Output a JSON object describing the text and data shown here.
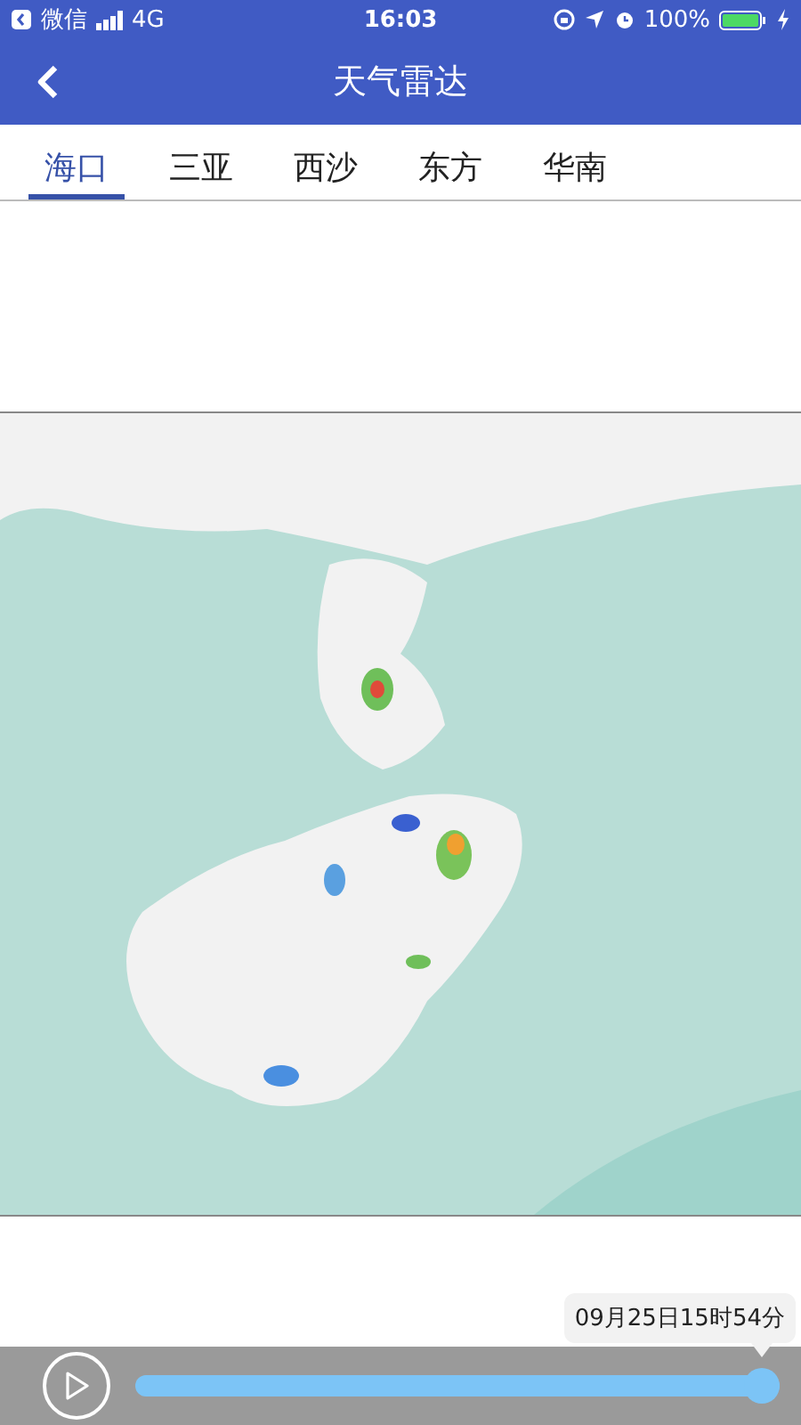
{
  "status_bar": {
    "back_app": "微信",
    "network": "4G",
    "time": "16:03",
    "battery": "100%"
  },
  "nav": {
    "title": "天气雷达"
  },
  "tabs": [
    {
      "label": "海口",
      "selected": true
    },
    {
      "label": "三亚",
      "selected": false
    },
    {
      "label": "西沙",
      "selected": false
    },
    {
      "label": "东方",
      "selected": false
    },
    {
      "label": "华南",
      "selected": false
    }
  ],
  "player": {
    "playing": false,
    "level": 1,
    "time_label": "09月25日15时54分"
  }
}
